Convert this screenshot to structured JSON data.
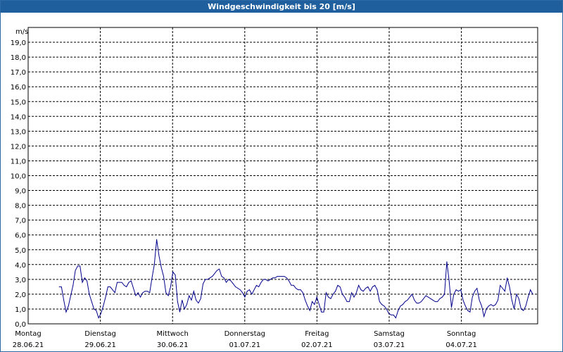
{
  "window": {
    "title": "Windgeschwindigkeit bis 20 [m/s]"
  },
  "chart_data": {
    "type": "line",
    "title": "Windgeschwindigkeit bis 20 [m/s]",
    "ylabel": "m/s",
    "ylim": [
      0,
      20
    ],
    "y_ticks": [
      "0,0",
      "1,0",
      "2,0",
      "3,0",
      "4,0",
      "5,0",
      "6,0",
      "7,0",
      "8,0",
      "9,0",
      "10,0",
      "11,0",
      "12,0",
      "13,0",
      "14,0",
      "15,0",
      "16,0",
      "17,0",
      "18,0",
      "19,0"
    ],
    "x_ticks": [
      {
        "day": "Montag",
        "date": "28.06.21"
      },
      {
        "day": "Dienstag",
        "date": "29.06.21"
      },
      {
        "day": "Mittwoch",
        "date": "30.06.21"
      },
      {
        "day": "Donnerstag",
        "date": "01.07.21"
      },
      {
        "day": "Freitag",
        "date": "02.07.21"
      },
      {
        "day": "Samstag",
        "date": "03.07.21"
      },
      {
        "day": "Sonntag",
        "date": "04.07.21"
      }
    ],
    "grid": true,
    "line_color": "#00008b",
    "series": [
      {
        "values": [
          2.5,
          2.5,
          1.6,
          0.8,
          1.2,
          1.9,
          2.6,
          3.6,
          3.9,
          3.9,
          2.8,
          3.1,
          2.9,
          2.0,
          1.5,
          1.0,
          0.9,
          0.4,
          0.7,
          1.2,
          1.8,
          2.5,
          2.5,
          2.3,
          2.1,
          2.8,
          2.8,
          2.8,
          2.6,
          2.5,
          2.8,
          2.9,
          2.4,
          1.9,
          2.1,
          1.8,
          2.1,
          2.2,
          2.2,
          2.1,
          3.1,
          4.0,
          5.7,
          4.6,
          3.8,
          3.2,
          2.1,
          1.9,
          2.5,
          3.5,
          3.3,
          1.5,
          0.8,
          1.6,
          1.0,
          1.3,
          1.9,
          1.6,
          2.2,
          1.6,
          1.4,
          1.7,
          2.7,
          3.0,
          3.0,
          3.1,
          3.2,
          3.4,
          3.6,
          3.7,
          3.2,
          3.1,
          2.8,
          3.0,
          2.9,
          2.7,
          2.5,
          2.4,
          2.3,
          2.1,
          1.8,
          2.2,
          2.3,
          2.0,
          2.3,
          2.6,
          2.5,
          2.8,
          3.0,
          3.0,
          2.9,
          3.0,
          3.1,
          3.1,
          3.2,
          3.2,
          3.2,
          3.2,
          3.1,
          2.9,
          2.6,
          2.6,
          2.4,
          2.3,
          2.3,
          2.1,
          1.6,
          1.2,
          0.9,
          1.5,
          1.3,
          1.8,
          1.3,
          0.8,
          0.8,
          2.1,
          1.8,
          1.7,
          2.0,
          2.2,
          2.6,
          2.5,
          2.0,
          1.8,
          1.5,
          1.5,
          2.1,
          1.8,
          2.1,
          2.6,
          2.3,
          2.2,
          2.4,
          2.5,
          2.2,
          2.5,
          2.6,
          2.3,
          1.5,
          1.3,
          1.2,
          1.0,
          0.7,
          0.6,
          0.6,
          0.4,
          0.9,
          1.2,
          1.3,
          1.5,
          1.6,
          1.8,
          2.0,
          1.6,
          1.4,
          1.4,
          1.5,
          1.7,
          1.9,
          1.8,
          1.7,
          1.6,
          1.5,
          1.5,
          1.7,
          1.8,
          2.0,
          4.2,
          2.9,
          1.1,
          2.0,
          2.3,
          2.2,
          2.3,
          1.6,
          1.2,
          0.9,
          0.8,
          1.8,
          2.2,
          2.4,
          1.6,
          1.2,
          0.5,
          1.0,
          1.2,
          1.3,
          1.2,
          1.3,
          1.6,
          2.6,
          2.4,
          2.2,
          3.1,
          2.5,
          1.6,
          1.0,
          2.0,
          1.7,
          1.0,
          0.9,
          1.2,
          1.8,
          2.3,
          2.0
        ]
      }
    ]
  }
}
